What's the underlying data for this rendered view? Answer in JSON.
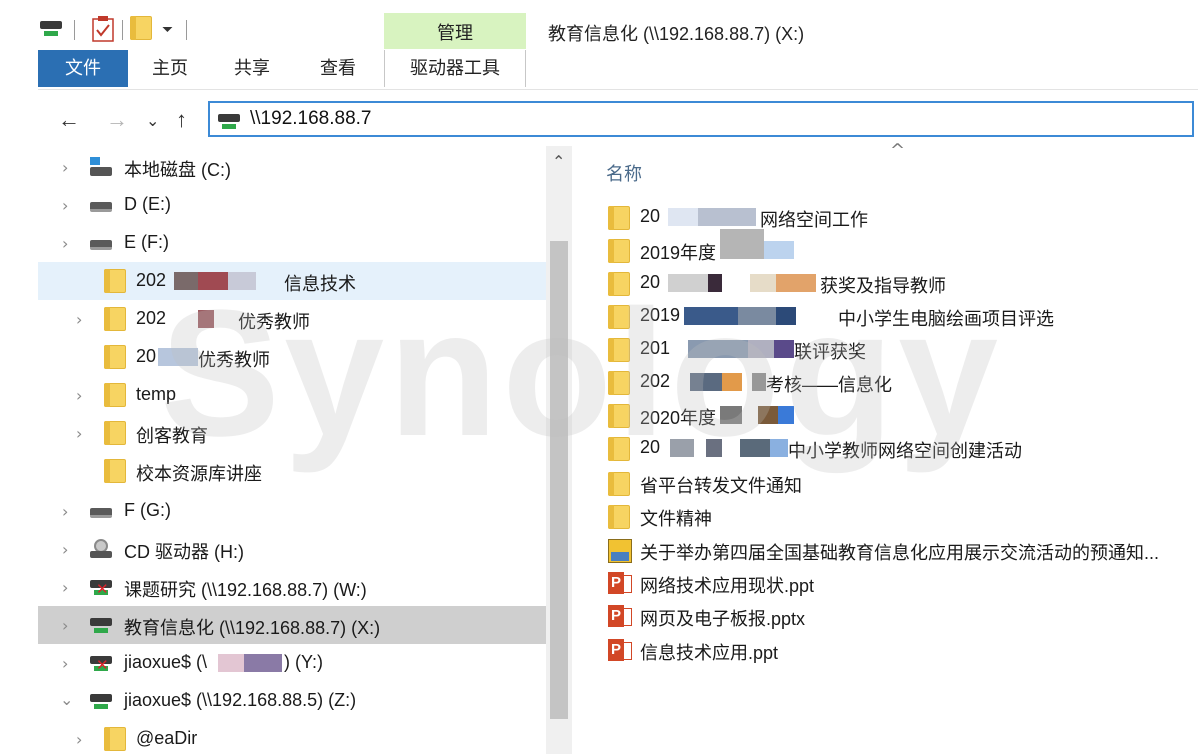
{
  "window": {
    "title": "教育信息化 (\\\\192.168.88.7) (X:)"
  },
  "ribbon": {
    "context_group": "管理",
    "tabs": {
      "file": "文件",
      "home": "主页",
      "share": "共享",
      "view": "查看",
      "drive_tools": "驱动器工具"
    }
  },
  "nav": {
    "back": "←",
    "forward": "→",
    "recent": "⌄",
    "up": "↑",
    "address": "\\\\192.168.88.7"
  },
  "tree": {
    "items": [
      {
        "label": "本地磁盘 (C:)",
        "icon": "local-disk-icon",
        "expandable": true
      },
      {
        "label": "D (E:)",
        "icon": "drive-icon",
        "expandable": true
      },
      {
        "label": "E (F:)",
        "icon": "drive-icon",
        "expandable": true
      },
      {
        "label_start": "202",
        "label_end": "信息技术",
        "icon": "folder-icon",
        "expandable": false,
        "state": "hover"
      },
      {
        "label_start": "202",
        "label_end": "优秀教师",
        "icon": "folder-icon",
        "expandable": true
      },
      {
        "label_start": "20",
        "label_end": "优秀教师",
        "icon": "folder-icon",
        "expandable": false
      },
      {
        "label": "temp",
        "icon": "folder-icon",
        "expandable": true
      },
      {
        "label": "创客教育",
        "icon": "folder-icon",
        "expandable": true
      },
      {
        "label": "校本资源库讲座",
        "icon": "folder-icon",
        "expandable": false
      },
      {
        "label": "F (G:)",
        "icon": "drive-icon",
        "expandable": true
      },
      {
        "label": "CD 驱动器 (H:)",
        "icon": "cd-drive-icon",
        "expandable": true
      },
      {
        "label": "课题研究 (\\\\192.168.88.7) (W:)",
        "icon": "disconnected-network-drive-icon",
        "expandable": true
      },
      {
        "label": "教育信息化 (\\\\192.168.88.7) (X:)",
        "icon": "network-drive-icon",
        "expandable": true,
        "state": "selected"
      },
      {
        "label_start": "jiaoxue$ (\\",
        "label_end": ") (Y:)",
        "icon": "disconnected-network-drive-icon",
        "expandable": true
      },
      {
        "label": "jiaoxue$ (\\\\192.168.88.5) (Z:)",
        "icon": "network-drive-icon",
        "expandable": true,
        "expanded": true
      },
      {
        "label": "@eaDir",
        "icon": "folder-icon",
        "expandable": true
      }
    ]
  },
  "content": {
    "sort_indicator": "^",
    "column_name": "名称",
    "files": [
      {
        "label_start": "20",
        "label_end": "网络空间工作",
        "icon": "folder-icon"
      },
      {
        "label_start": "2019年度",
        "label_end": "",
        "icon": "folder-icon"
      },
      {
        "label_start": "20",
        "label_end": "获奖及指导教师",
        "icon": "folder-icon"
      },
      {
        "label_start": "2019",
        "label_end": "中小学生电脑绘画项目评选",
        "icon": "folder-icon"
      },
      {
        "label_start": "201",
        "label_end": "联评获奖",
        "icon": "folder-icon"
      },
      {
        "label_start": "202",
        "label_end": "考核——信息化",
        "icon": "folder-icon"
      },
      {
        "label_start": "2020年度",
        "label_end": "",
        "icon": "folder-icon"
      },
      {
        "label_start": "20",
        "label_end": "中小学教师网络空间创建活动",
        "icon": "folder-icon"
      },
      {
        "label": "省平台转发文件通知",
        "icon": "folder-icon"
      },
      {
        "label": "文件精神",
        "icon": "folder-icon"
      },
      {
        "label": "关于举办第四届全国基础教育信息化应用展示交流活动的预通知...",
        "icon": "image-file-icon"
      },
      {
        "label": "网络技术应用现状.ppt",
        "icon": "powerpoint-icon"
      },
      {
        "label": "网页及电子板报.pptx",
        "icon": "powerpoint-icon"
      },
      {
        "label": "信息技术应用.ppt",
        "icon": "powerpoint-icon"
      }
    ]
  },
  "watermark": "Synology",
  "colors": {
    "accent": "#2b6fb3",
    "context_tab": "#d8f3c0",
    "selection": "#cfcfcf",
    "hover": "#e5f1fb",
    "address_border": "#3c8ad6",
    "folder": "#f7d462"
  }
}
